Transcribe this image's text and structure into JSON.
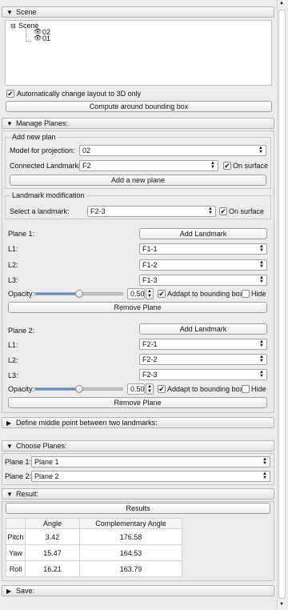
{
  "scene": {
    "header": "Scene",
    "tree": {
      "root": "Scene",
      "children": [
        "02",
        "01"
      ]
    },
    "auto_layout_label": "Automatically change layout to 3D only",
    "compute_button": "Compute around bounding box"
  },
  "manage": {
    "header": "Manage Planes:",
    "add_new_plan": {
      "title": "Add new plan",
      "model_label": "Model for projection:",
      "model_value": "02",
      "landmarks_label": "Connected Landmarks:",
      "landmarks_value": "F2",
      "on_surface": "On surface",
      "add_button": "Add a new plane"
    },
    "landmark_mod": {
      "title": "Landmark modification",
      "select_label": "Select a landmark:",
      "select_value": "F2-3",
      "on_surface": "On surface"
    },
    "plane1": {
      "title": "Plane 1:",
      "add_landmark": "Add Landmark",
      "l1_label": "L1:",
      "l1_value": "F1-1",
      "l2_label": "L2:",
      "l2_value": "F1-2",
      "l3_label": "L3:",
      "l3_value": "F1-3",
      "opacity_label": "Opacity:",
      "opacity_value": "0.50",
      "addapt_label": "Addapt to bounding box",
      "hide_label": "Hide",
      "remove_button": "Remove Plane"
    },
    "plane2": {
      "title": "Plane 2:",
      "add_landmark": "Add Landmark",
      "l1_label": "L1:",
      "l1_value": "F2-1",
      "l2_label": "L2:",
      "l2_value": "F2-2",
      "l3_label": "L3:",
      "l3_value": "F2-3",
      "opacity_label": "Opacity:",
      "opacity_value": "0.50",
      "addapt_label": "Addapt to bounding box",
      "hide_label": "Hide",
      "remove_button": "Remove Plane"
    }
  },
  "middle_point": {
    "header": "Define middle point between two landmarks:"
  },
  "choose": {
    "header": "Choose Planes:",
    "plane1_label": "Plane 1:",
    "plane1_value": "Plane 1",
    "plane2_label": "Plane 2:",
    "plane2_value": "Plane 2"
  },
  "result": {
    "header": "Result:",
    "results_button": "Results",
    "columns": [
      "",
      "Angle",
      "Complementary Angle"
    ],
    "rows": [
      {
        "name": "Pitch",
        "angle": "3.42",
        "comp": "176.58"
      },
      {
        "name": "Yaw",
        "angle": "15.47",
        "comp": "164.53"
      },
      {
        "name": "Roll",
        "angle": "16.21",
        "comp": "163.79"
      }
    ]
  },
  "save": {
    "header": "Save:"
  },
  "icons": {
    "check": "✔",
    "collapse": "▼",
    "expand": "▶",
    "eye": "eye-icon"
  },
  "colors": {
    "slider_fill": "#5a8fd8"
  },
  "opacity_fraction": 0.5
}
